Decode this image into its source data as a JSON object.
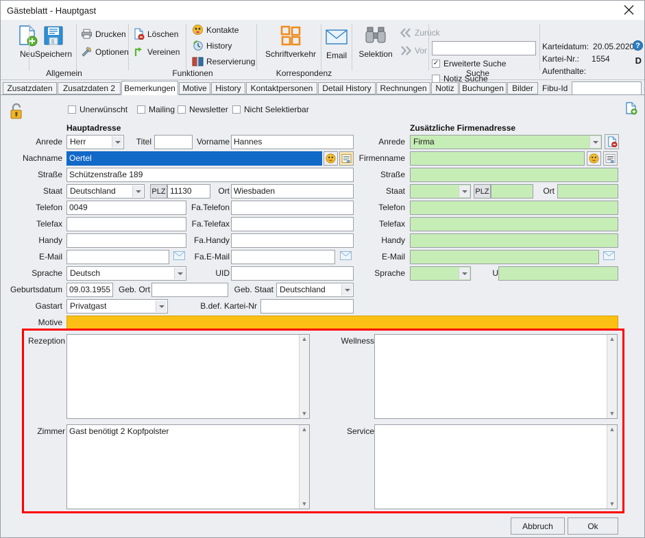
{
  "window": {
    "title": "Gästeblatt - Hauptgast",
    "close_label": "×"
  },
  "ribbon": {
    "groups": [
      {
        "name": "Allgemein",
        "label": "Allgemein"
      },
      {
        "name": "Funktionen",
        "label": "Funktionen"
      },
      {
        "name": "Korrespondenz",
        "label": "Korrespondenz"
      },
      {
        "name": "Suche",
        "label": "Suche"
      }
    ],
    "buttons": {
      "neu": "Neu",
      "speichern": "Speichern",
      "drucken": "Drucken",
      "optionen": "Optionen",
      "loeschen": "Löschen",
      "vereinen": "Vereinen",
      "kontakte": "Kontakte",
      "history": "History",
      "reservierung": "Reservierung",
      "schriftverkehr": "Schriftverkehr",
      "email": "Email",
      "selektion": "Selektion",
      "zurueck": "Zurück",
      "vor": "Vor"
    },
    "search": {
      "value": "",
      "erweiterte_suche_label": "Erweiterte Suche",
      "erweiterte_suche_checked": true,
      "notiz_suche_label": "Notiz Suche",
      "notiz_suche_checked": false
    },
    "info": {
      "karteidatum_label": "Karteidatum:",
      "karteidatum_value": "20.05.2020",
      "kartei_nr_label": "Kartei-Nr.:",
      "kartei_nr_value": "1554",
      "aufenthalte_label": "Aufenthalte:",
      "aufenthalte_value": "",
      "fibu_label": "Fibu-Id",
      "fibu_value": "",
      "help_glyph": "?",
      "d_badge": "D"
    }
  },
  "tabs": [
    {
      "label": "Zusatzdaten",
      "active": false
    },
    {
      "label": "Zusatzdaten 2",
      "active": false
    },
    {
      "label": "Bemerkungen",
      "active": true
    },
    {
      "label": "Motive",
      "active": false
    },
    {
      "label": "History",
      "active": false
    },
    {
      "label": "Kontaktpersonen",
      "active": false
    },
    {
      "label": "Detail History",
      "active": false
    },
    {
      "label": "Rechnungen",
      "active": false
    },
    {
      "label": "Notiz",
      "active": false
    },
    {
      "label": "Buchungen",
      "active": false
    },
    {
      "label": "Bilder",
      "active": false
    }
  ],
  "flags": [
    {
      "label": "Unerwünscht",
      "checked": false
    },
    {
      "label": "Mailing",
      "checked": false
    },
    {
      "label": "Newsletter",
      "checked": false
    },
    {
      "label": "Nicht Selektierbar",
      "checked": false
    }
  ],
  "main_address": {
    "header": "Hauptadresse",
    "anrede_label": "Anrede",
    "anrede_value": "Herr",
    "titel_label": "Titel",
    "titel_value": "",
    "vorname_label": "Vorname",
    "vorname_value": "Hannes",
    "nachname_label": "Nachname",
    "nachname_value": "Oertel",
    "strasse_label": "Straße",
    "strasse_value": "Schützenstraße 189",
    "staat_label": "Staat",
    "staat_value": "Deutschland",
    "plz_label": "PLZ",
    "plz_value": "11130",
    "ort_label": "Ort",
    "ort_value": "Wiesbaden",
    "telefon_label": "Telefon",
    "telefon_value": "0049",
    "telefax_label": "Telefax",
    "telefax_value": "",
    "handy_label": "Handy",
    "handy_value": "",
    "email_label": "E-Mail",
    "email_value": "",
    "sprache_label": "Sprache",
    "sprache_value": "Deutsch",
    "uid_label": "UID",
    "uid_value": "",
    "fa_telefon_label": "Fa.Telefon",
    "fa_telefon_value": "",
    "fa_telefax_label": "Fa.Telefax",
    "fa_telefax_value": "",
    "fa_handy_label": "Fa.Handy",
    "fa_handy_value": "",
    "fa_email_label": "Fa.E-Mail",
    "fa_email_value": "",
    "geburtsdatum_label": "Geburtsdatum",
    "geburtsdatum_value": "09.03.1955",
    "geb_ort_label": "Geb. Ort",
    "geb_ort_value": "",
    "geb_staat_label": "Geb. Staat",
    "geb_staat_value": "Deutschland",
    "gastart_label": "Gastart",
    "gastart_value": "Privatgast",
    "bdef_label": "B.def. Kartei-Nr",
    "bdef_value": "",
    "motive_label": "Motive",
    "motive_value": ""
  },
  "company_address": {
    "header": "Zusätzliche Firmenadresse",
    "anrede_label": "Anrede",
    "anrede_value": "Firma",
    "firmenname_label": "Firmenname",
    "firmenname_value": "",
    "strasse_label": "Straße",
    "strasse_value": "",
    "staat_label": "Staat",
    "staat_value": "",
    "plz_label": "PLZ",
    "plz_value": "",
    "ort_label": "Ort",
    "ort_value": "",
    "telefon_label": "Telefon",
    "telefon_value": "",
    "telefax_label": "Telefax",
    "telefax_value": "",
    "handy_label": "Handy",
    "handy_value": "",
    "email_label": "E-Mail",
    "email_value": "",
    "sprache_label": "Sprache",
    "sprache_value": "",
    "uid_label": "UID",
    "uid_value": ""
  },
  "remarks": {
    "rezeption_label": "Rezeption",
    "rezeption_value": "",
    "wellness_label": "Wellness",
    "wellness_value": "",
    "zimmer_label": "Zimmer",
    "zimmer_value": "Gast benötigt 2 Kopfpolster",
    "service_label": "Service",
    "service_value": ""
  },
  "footer": {
    "abbruch": "Abbruch",
    "ok": "Ok"
  },
  "colors": {
    "accent_red": "#ff0000",
    "selection_blue": "#1269c8",
    "company_green": "#c7edb7",
    "motive_yellow": "#fbc013",
    "window_bg": "#eceef1"
  }
}
